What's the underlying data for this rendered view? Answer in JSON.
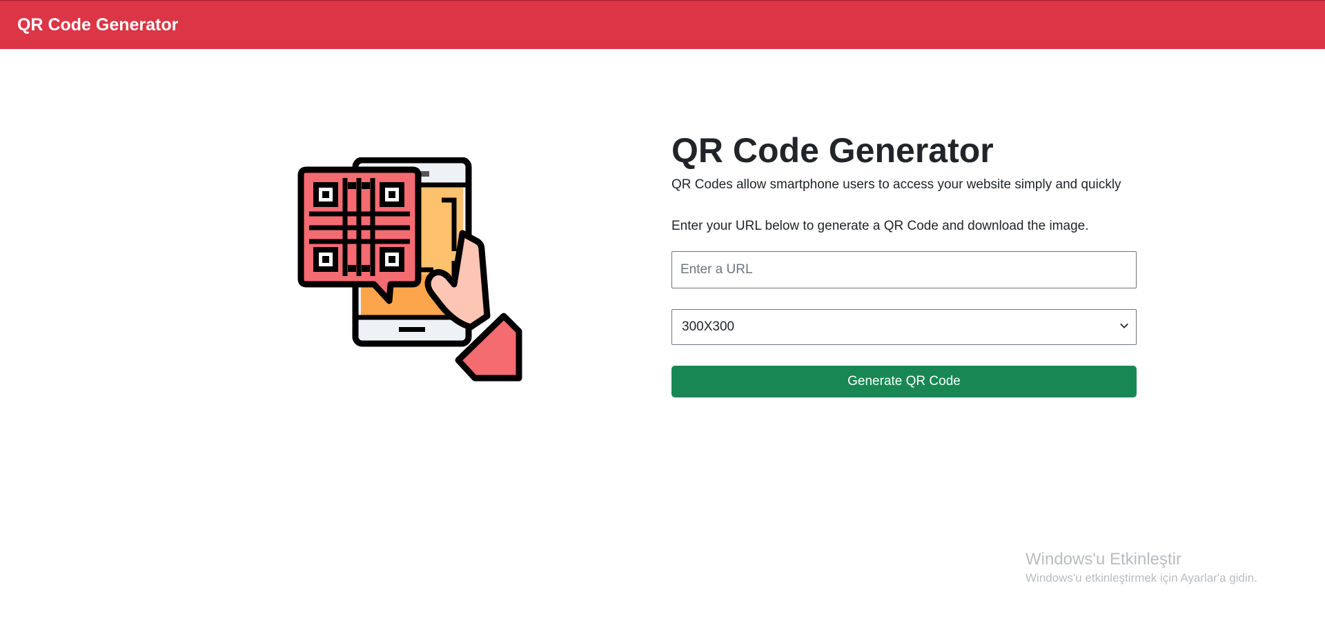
{
  "navbar": {
    "brand": "QR Code Generator",
    "color": "#dc3545"
  },
  "illustration": {
    "icon": "phone-qr-code-icon"
  },
  "main": {
    "title": "QR Code Generator",
    "intro": "QR Codes allow smartphone users to access your website simply and quickly",
    "instruction": "Enter your URL below to generate a QR Code and download the image.",
    "url_input": {
      "value": "",
      "placeholder": "Enter a URL"
    },
    "size_select": {
      "selected": "300X300"
    },
    "generate_button": {
      "label": "Generate QR Code",
      "color": "#198754"
    }
  },
  "watermark": {
    "title": "Windows'u Etkinleştir",
    "subtitle": "Windows'u etkinleştirmek için Ayarlar'a gidin."
  }
}
